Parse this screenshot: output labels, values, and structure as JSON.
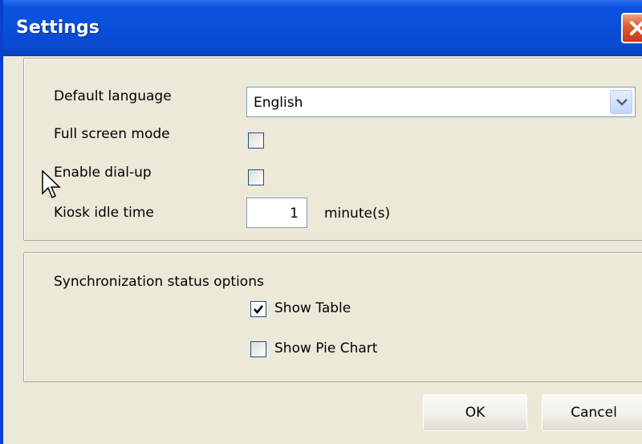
{
  "window": {
    "title": "Settings"
  },
  "general": {
    "language_label": "Default language",
    "language_value": "English",
    "fullscreen_label": "Full screen mode",
    "fullscreen_checked": false,
    "dialup_label": "Enable dial-up",
    "dialup_checked": false,
    "idle_label": "Kiosk idle time",
    "idle_value": "1",
    "idle_unit": "minute(s)"
  },
  "sync": {
    "heading": "Synchronization status options",
    "show_table_label": "Show Table",
    "show_table_checked": true,
    "show_pie_label": "Show Pie Chart",
    "show_pie_checked": false
  },
  "buttons": {
    "ok": "OK",
    "cancel": "Cancel"
  }
}
